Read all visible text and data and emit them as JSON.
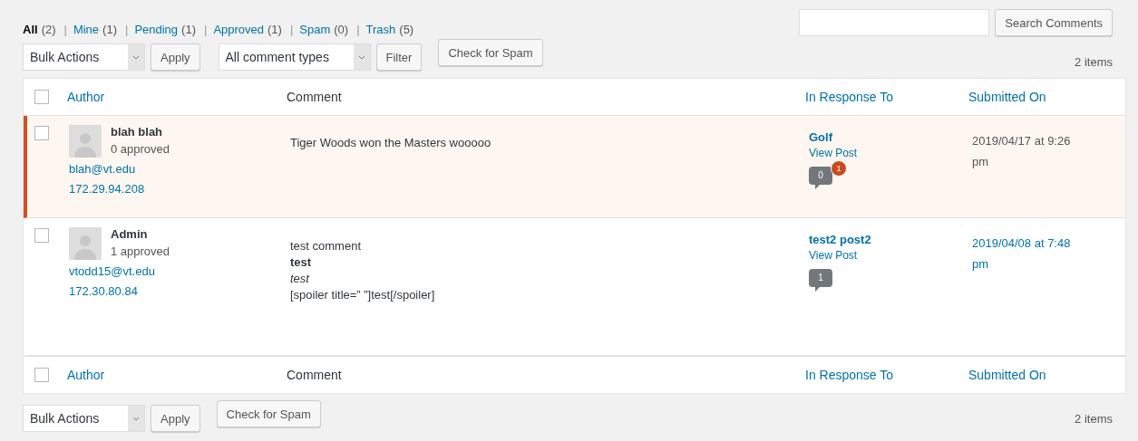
{
  "filters": [
    {
      "label": "All",
      "count": "(2)",
      "selected": true
    },
    {
      "separator": "|",
      "label": "Mine",
      "count": "(1)",
      "selected": false
    },
    {
      "separator": "|",
      "label": "Pending",
      "count": "(1)",
      "selected": false
    },
    {
      "separator": "|",
      "label": "Approved",
      "count": "(1)",
      "selected": false
    },
    {
      "separator": "|",
      "label": "Spam",
      "count": "(0)",
      "selected": false
    },
    {
      "separator": "|",
      "label": "Trash",
      "count": "(5)",
      "selected": false
    }
  ],
  "search": {
    "button": "Search Comments"
  },
  "top_nav": {
    "bulk_actions": "Bulk Actions",
    "apply": "Apply",
    "type_filter": "All comment types",
    "filter": "Filter",
    "check_spam": "Check for Spam",
    "items": "2 items"
  },
  "columns": {
    "select_all_checked": false,
    "author": "Author",
    "comment": "Comment",
    "response": "In Response To",
    "submitted": "Submitted On"
  },
  "footer_columns": {
    "select_all_checked": false,
    "author": "Author",
    "comment": "Comment",
    "response": "In Response To",
    "submitted": "Submitted On"
  },
  "rows": [
    {
      "checked": false,
      "pending": true,
      "author": "blah blah",
      "approved": "0 approved",
      "email": "blah@vt.edu",
      "ip": "172.29.94.208",
      "lines": [
        {
          "kind": "normal",
          "text": "Tiger Woods won the Masters wooooo"
        }
      ],
      "post": "Golf",
      "view": "View Post",
      "bubble": "0",
      "pending_badge": "1",
      "date": "2019/04/17 at 9:26 pm"
    },
    {
      "checked": false,
      "pending": false,
      "author": "Admin",
      "approved": "1 approved",
      "email": "vtodd15@vt.edu",
      "ip": "172.30.80.84",
      "lines": [
        {
          "kind": "normal",
          "text": "test comment"
        },
        {
          "kind": "bold",
          "text": "test"
        },
        {
          "kind": "italic",
          "text": "test"
        },
        {
          "kind": "normal",
          "text": "[spoiler title=” ”]test[/spoiler]"
        }
      ],
      "post": "test2 post2",
      "view": "View Post",
      "bubble": "1",
      "date": "2019/04/08 at 7:48 pm"
    }
  ],
  "bottom_nav": {
    "bulk_actions": "Bulk Actions",
    "apply": "Apply",
    "check_spam": "Check for Spam",
    "items": "2 items"
  }
}
